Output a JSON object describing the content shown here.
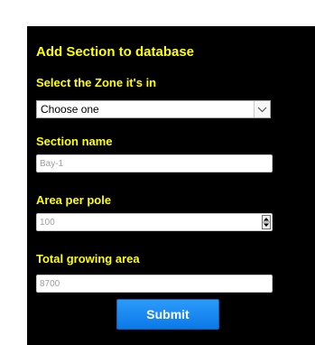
{
  "form": {
    "title": "Add Section to database",
    "zone": {
      "label": "Select the Zone it's in",
      "selected": "Choose one",
      "icon": "chevron-down-icon"
    },
    "section_name": {
      "label": "Section name",
      "placeholder": "Bay-1",
      "value": ""
    },
    "area_per_pole": {
      "label": "Area per pole",
      "placeholder": "100",
      "value": "",
      "icon": "spinner-arrows-icon"
    },
    "total_growing_area": {
      "label": "Total growing area",
      "placeholder": "8700",
      "value": ""
    },
    "submit_label": "Submit"
  },
  "colors": {
    "panel_background": "#000000",
    "label_color": "#ffff00",
    "button_blue": "#1a8af0",
    "page_background": "#ffffff"
  }
}
